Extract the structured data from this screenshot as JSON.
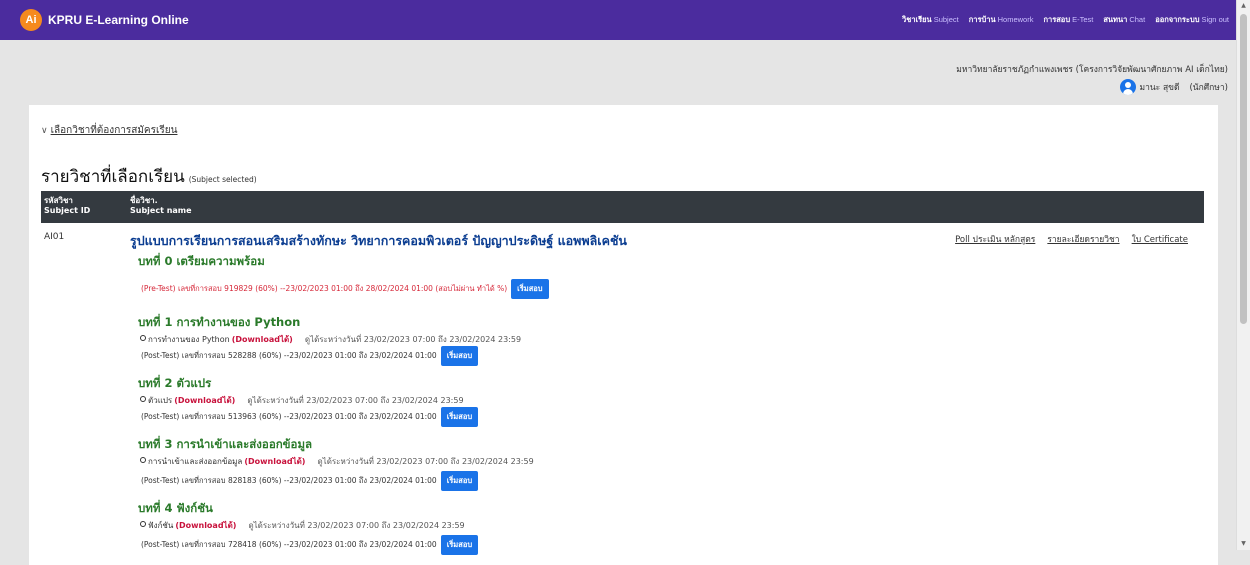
{
  "app": {
    "logo": "Ai",
    "title": "KPRU E-Learning Online"
  },
  "nav": [
    {
      "th": "วิชาเรียน",
      "en": "Subject"
    },
    {
      "th": "การบ้าน",
      "en": "Homework"
    },
    {
      "th": "การสอบ",
      "en": "E-Test"
    },
    {
      "th": "สนทนา",
      "en": "Chat"
    },
    {
      "th": "ออกจากระบบ",
      "en": "Sign out"
    }
  ],
  "org": "มหาวิทยาลัยราชภัฏกำแพงเพชร (โครงการวิจัยพัฒนาศักยภาพ AI เด็กไทย)",
  "user": {
    "name": "มานะ สุขดี",
    "role": "(นักศึกษา)"
  },
  "enroll_toggle": "เลือกวิชาที่ต้องการสมัครเรียน",
  "section": {
    "title": "รายวิชาที่เลือกเรียน",
    "subtitle": "(Subject selected)"
  },
  "table": {
    "col1_th": "รหัสวิชา",
    "col1_en": "Subject ID",
    "col2_th": "ชื่อวิชา.",
    "col2_en": "Subject name"
  },
  "subject": {
    "id": "AI01",
    "name": "รูปแบบการเรียนการสอนเสริมสร้างทักษะ วิทยาการคอมพิวเตอร์ ปัญญาประดิษฐ์ แอพพลิเคชัน",
    "links": [
      "Poll ประเมิน หลักสูตร",
      "รายละเอียดรายวิชา",
      "ใบ Certificate"
    ]
  },
  "start_button": "เริ่มสอบ",
  "lessons": [
    {
      "title": "บทที่ 0 เตรียมความพร้อม",
      "test": "(Pre-Test) เลขที่การสอบ 919829 (60%) --23/02/2023 01:00 ถึง 28/02/2024 01:00 (สอบไม่ผ่าน ทำได้ %)"
    },
    {
      "title": "บทที่ 1 การทำงานของ Python",
      "material": "การทำงานของ Python",
      "download": "(Downloadได้)",
      "period": "ดูได้ระหว่างวันที่ 23/02/2023 07:00 ถึง 23/02/2024 23:59",
      "test": "(Post-Test) เลขที่การสอบ 528288 (60%) --23/02/2023 01:00 ถึง 23/02/2024 01:00"
    },
    {
      "title": "บทที่ 2 ตัวแปร",
      "material": "ตัวแปร",
      "download": "(Downloadได้)",
      "period": "ดูได้ระหว่างวันที่ 23/02/2023 07:00 ถึง 23/02/2024 23:59",
      "test": "(Post-Test) เลขที่การสอบ 513963 (60%) --23/02/2023 01:00 ถึง 23/02/2024 01:00"
    },
    {
      "title": "บทที่ 3 การนำเข้าและส่งออกข้อมูล",
      "material": "การนำเข้าและส่งออกข้อมูล",
      "download": "(Downloadได้)",
      "period": "ดูได้ระหว่างวันที่ 23/02/2023 07:00 ถึง 23/02/2024 23:59",
      "test": "(Post-Test) เลขที่การสอบ 828183 (60%) --23/02/2023 01:00 ถึง 23/02/2024 01:00"
    },
    {
      "title": "บทที่ 4 ฟังก์ชัน",
      "material": "ฟังก์ชัน",
      "download": "(Downloadได้)",
      "period": "ดูได้ระหว่างวันที่ 23/02/2023 07:00 ถึง 23/02/2024 23:59",
      "test": "(Post-Test) เลขที่การสอบ 728418 (60%) --23/02/2023 01:00 ถึง 23/02/2024 01:00"
    }
  ]
}
